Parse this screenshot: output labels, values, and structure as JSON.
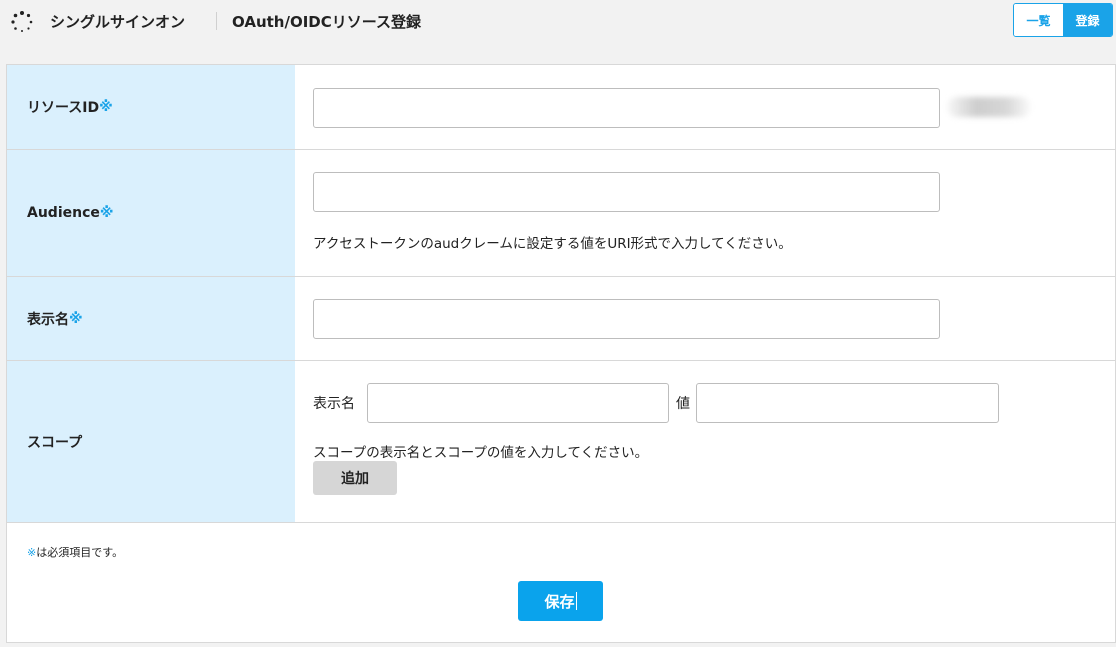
{
  "header": {
    "app_title": "シングルサインオン",
    "page_title": "OAuth/OIDCリソース登録",
    "list_button": "一覧",
    "register_button": "登録"
  },
  "form": {
    "resource_id": {
      "label": "リソースID",
      "required_mark": "※",
      "value": ""
    },
    "audience": {
      "label": "Audience",
      "required_mark": "※",
      "value": "",
      "help": "アクセストークンのaudクレームに設定する値をURI形式で入力してください。"
    },
    "display_name": {
      "label": "表示名",
      "required_mark": "※",
      "value": ""
    },
    "scope": {
      "label": "スコープ",
      "name_label": "表示名",
      "name_value": "",
      "value_label": "値",
      "value_value": "",
      "help": "スコープの表示名とスコープの値を入力してください。",
      "add_button": "追加"
    }
  },
  "footer": {
    "note_mark": "※",
    "note_text": "は必須項目です。",
    "save_button": "保存"
  },
  "colors": {
    "accent": "#1aa3e8",
    "label_bg": "#daf0fd",
    "add_button_bg": "#d6d6d6"
  }
}
